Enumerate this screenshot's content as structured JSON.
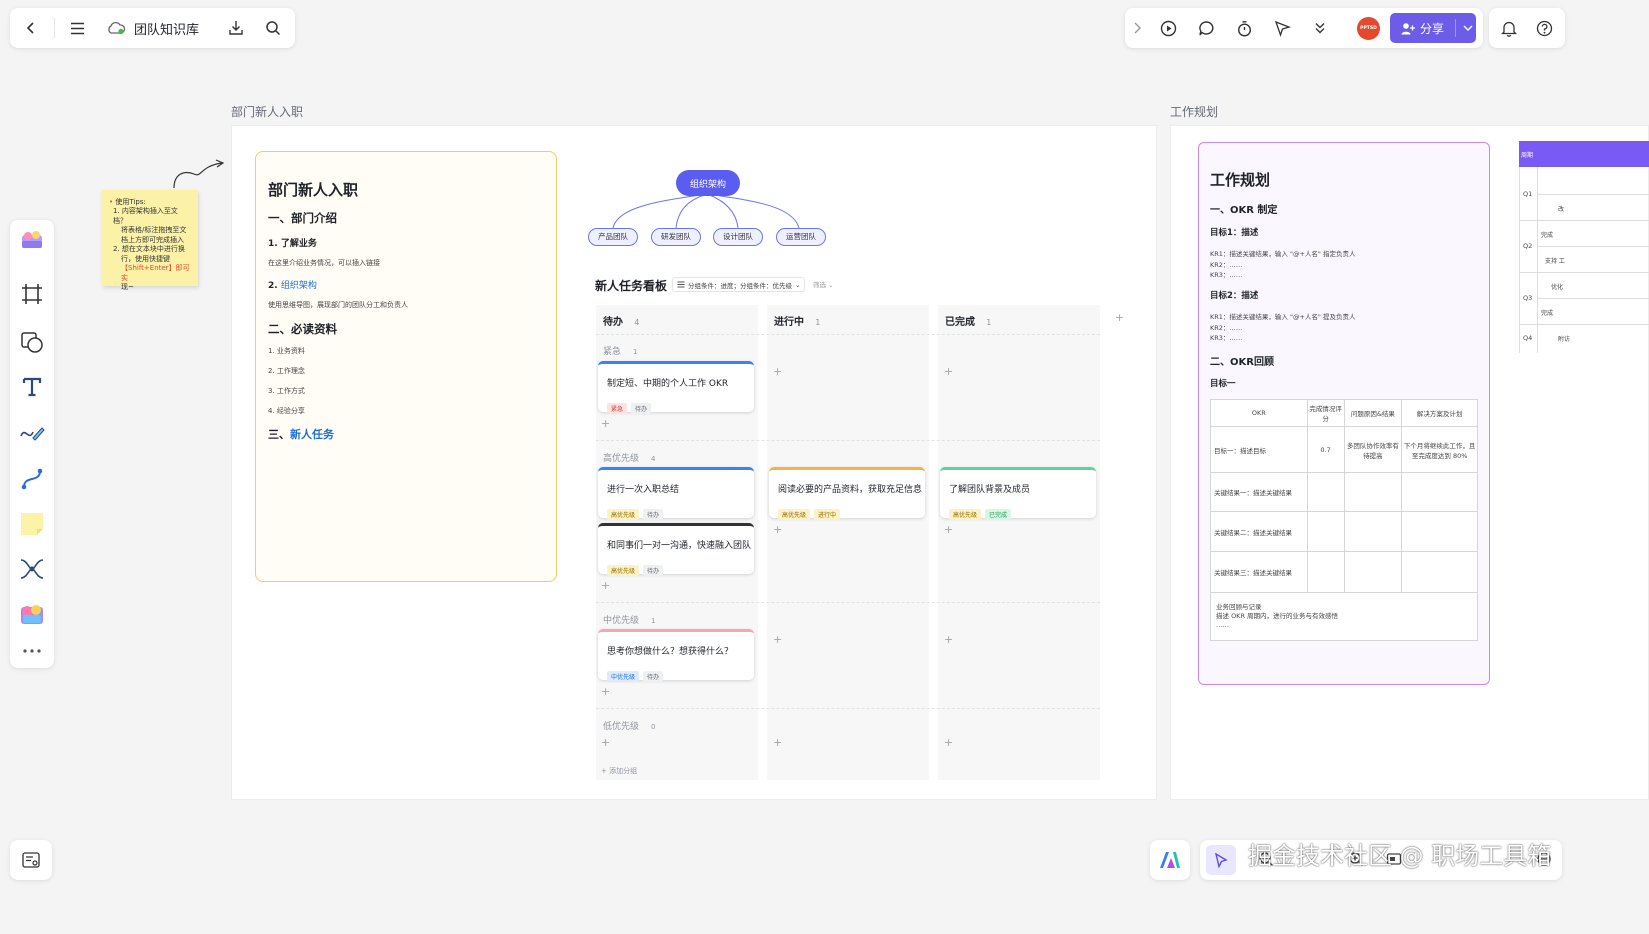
{
  "topbar": {
    "workspace": "团队知识库",
    "share_label": "分享",
    "avatar_text": "PPTSD"
  },
  "frames": {
    "left_label": "部门新人入职",
    "right_label": "工作规划"
  },
  "sticky": {
    "title": "使用Tips:",
    "lines": [
      "1. 内容架构插入至文档？",
      "将表格/标注拖拽至文",
      "档上方即可完成插入",
      "2. 想在文本块中进行换",
      "行，使用快捷键",
      "【Shift+Enter】即可实",
      "现~"
    ]
  },
  "doc": {
    "title": "部门新人入职",
    "s1": "一、部门介绍",
    "s1_1": "1. 了解业务",
    "s1_1_desc": "在这里介绍业务情况，可以插入链接",
    "s1_2_num": "2.",
    "s1_2_link": "组织架构",
    "s1_2_desc": "使用思维导图，展现部门的团队分工和负责人",
    "s2": "二、必读资料",
    "s2_items": [
      "1. 业务资料",
      "2. 工作理念",
      "3. 工作方式",
      "4. 经验分享"
    ],
    "s3_num": "三、",
    "s3_link": "新人任务"
  },
  "mindmap": {
    "root": "组织架构",
    "children": [
      "产品团队",
      "研发团队",
      "设计团队",
      "运营团队"
    ]
  },
  "kanban": {
    "title": "新人任务看板",
    "filter": "分组条件：进度；分组条件：优先级",
    "filter2": "筛选",
    "columns": [
      {
        "name": "待办",
        "count": "4"
      },
      {
        "name": "进行中",
        "count": "1"
      },
      {
        "name": "已完成",
        "count": "1"
      }
    ],
    "groups": [
      {
        "name": "紧急",
        "count": "1"
      },
      {
        "name": "高优先级",
        "count": "4"
      },
      {
        "name": "中优先级",
        "count": "1"
      },
      {
        "name": "低优先级",
        "count": "0"
      }
    ],
    "cards": {
      "c1": {
        "title": "制定短、中期的个人工作 OKR",
        "tag1": "紧急",
        "tag2": "待办"
      },
      "c2": {
        "title": "进行一次入职总结",
        "tag1": "高优先级",
        "tag2": "待办"
      },
      "c3": {
        "title": "和同事们一对一沟通，快速融入团队",
        "tag1": "高优先级",
        "tag2": "待办"
      },
      "c4": {
        "title": "思考你想做什么？想获得什么？",
        "tag1": "中优先级",
        "tag2": "待办"
      },
      "c5": {
        "title": "阅读必要的产品资料，获取充足信息",
        "tag1": "高优先级",
        "tag2": "进行中"
      },
      "c6": {
        "title": "了解团队背景及成员",
        "tag1": "高优先级",
        "tag2": "已完成"
      }
    },
    "add_group": "+ 添加分组"
  },
  "okr": {
    "title": "工作规划",
    "s1": "一、OKR 制定",
    "goal1": "目标1：描述",
    "goal1_krs": [
      "KR1：描述关键结果，输入 \"@+人名\" 指定负责人",
      "KR2：……",
      "KR3：……"
    ],
    "goal2": "目标2：描述",
    "goal2_krs": [
      "KR1：描述关键结果，输入 \"@+人名\" 提及负责人",
      "KR2：……",
      "KR3：……"
    ],
    "s2": "二、OKR回顾",
    "goal_a": "目标一",
    "table_head": [
      "OKR",
      "完成情况评分",
      "问题原因&结果",
      "解决方案及计划"
    ],
    "row1": [
      "目标一：描述目标",
      "0.7",
      "多团队协作效率有待提高",
      "下个月将继续此工作，且至完成度达到 80%"
    ],
    "row2": [
      "关键结果一：描述关键结果",
      "",
      "",
      ""
    ],
    "row3": [
      "关键结果二：描述关键结果",
      "",
      "",
      ""
    ],
    "row4": [
      "关键结果三：描述关键结果",
      "",
      "",
      ""
    ],
    "footer1": "业务回顾与记录",
    "footer2": "描述 OKR 周期内，进行的业务与有效感悟",
    "footer3": "……"
  },
  "quarter_table": {
    "head": "周期",
    "rows": [
      "Q1",
      "Q2",
      "Q3",
      "Q4"
    ],
    "cells": [
      "改",
      "完成",
      "支持 工",
      "优化",
      "完成",
      "附访"
    ]
  },
  "watermark": "掘金技术社区 @ 职场工具箱"
}
